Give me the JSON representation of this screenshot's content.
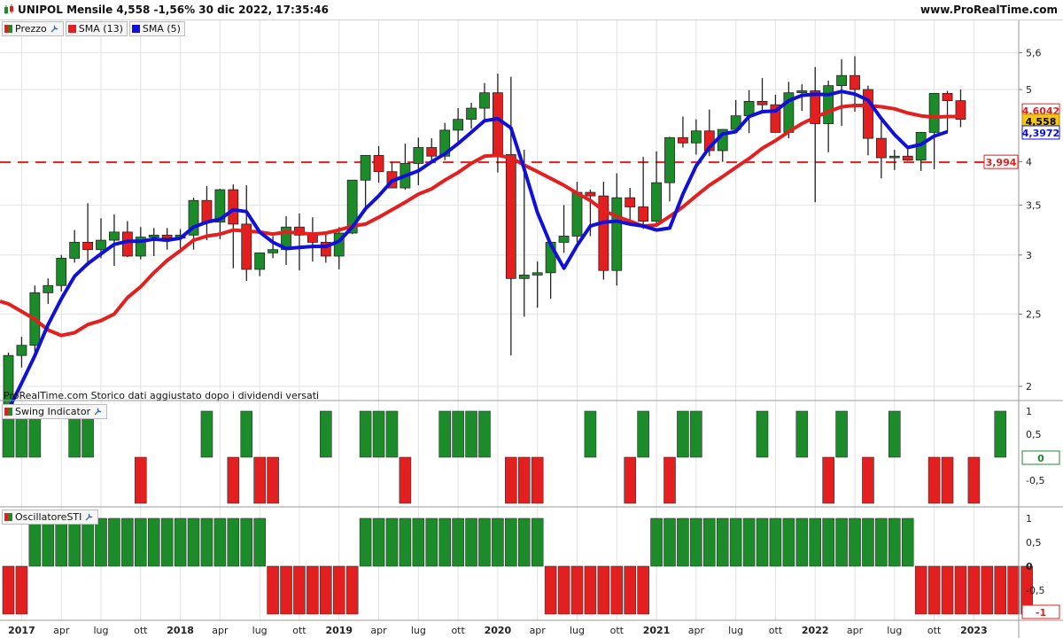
{
  "header": {
    "title": "UNIPOL Mensile 4,558 -1,56% 30 dic 2022, 17:35:46",
    "site": "www.ProRealTime.com"
  },
  "price_panel": {
    "legend": [
      "Prezzo",
      "SMA (13)",
      "SMA (5)"
    ],
    "note": "ProRealTime.com Storico dati aggiustato dopo i dividendi versati",
    "last_price_label": "4,558",
    "sma13_label": "4,6042",
    "sma5_label": "4,3972",
    "hline_label": "3,994"
  },
  "swing_panel": {
    "legend": "Swing Indicator"
  },
  "osc_panel": {
    "legend": "OscillatoreSTI"
  },
  "colors": {
    "up": "#1c8c2a",
    "down": "#e41f1f",
    "sma13": "#e41f1f",
    "sma5": "#1010d8",
    "last": "#f5c518"
  },
  "chart_data": [
    {
      "type": "candlestick",
      "title": "UNIPOL Mensile",
      "y_ticks": [
        2,
        2.5,
        3,
        3.5,
        4,
        5,
        5.6
      ],
      "y_tick_labels": [
        "2",
        "2,5",
        "3",
        "3,5",
        "4",
        "5",
        "5,6"
      ],
      "x_tick_labels": [
        "2017",
        "apr",
        "lug",
        "ott",
        "2018",
        "apr",
        "lug",
        "ott",
        "2019",
        "apr",
        "lug",
        "ott",
        "2020",
        "apr",
        "lug",
        "ott",
        "2021",
        "apr",
        "lug",
        "ott",
        "2022",
        "apr",
        "lug",
        "ott",
        "2023"
      ],
      "ylim": [
        1.65,
        5.7
      ],
      "scale": "log",
      "hline": 3.994,
      "x": [
        "2016-12",
        "2017-01",
        "2017-02",
        "2017-03",
        "2017-04",
        "2017-05",
        "2017-06",
        "2017-07",
        "2017-08",
        "2017-09",
        "2017-10",
        "2017-11",
        "2017-12",
        "2018-01",
        "2018-02",
        "2018-03",
        "2018-04",
        "2018-05",
        "2018-06",
        "2018-07",
        "2018-08",
        "2018-09",
        "2018-10",
        "2018-11",
        "2018-12",
        "2019-01",
        "2019-02",
        "2019-03",
        "2019-04",
        "2019-05",
        "2019-06",
        "2019-07",
        "2019-08",
        "2019-09",
        "2019-10",
        "2019-11",
        "2019-12",
        "2020-01",
        "2020-02",
        "2020-03",
        "2020-04",
        "2020-05",
        "2020-06",
        "2020-07",
        "2020-08",
        "2020-09",
        "2020-10",
        "2020-11",
        "2020-12",
        "2021-01",
        "2021-02",
        "2021-03",
        "2021-04",
        "2021-05",
        "2021-06",
        "2021-07",
        "2021-08",
        "2021-09",
        "2021-10",
        "2021-11",
        "2021-12",
        "2022-01",
        "2022-02",
        "2022-03",
        "2022-04",
        "2022-05",
        "2022-06",
        "2022-07",
        "2022-08",
        "2022-09",
        "2022-10",
        "2022-11",
        "2022-12"
      ],
      "open": [
        1.78,
        2.2,
        2.27,
        2.67,
        2.73,
        2.97,
        3.12,
        3.05,
        3.14,
        3.22,
        2.99,
        3.17,
        3.19,
        3.16,
        3.19,
        3.55,
        3.32,
        3.67,
        3.3,
        2.87,
        3.02,
        3.05,
        3.27,
        3.19,
        3.12,
        2.99,
        3.21,
        3.78,
        4.08,
        3.88,
        3.69,
        3.98,
        4.18,
        4.07,
        4.41,
        4.56,
        4.72,
        4.95,
        4.09,
        2.79,
        2.82,
        2.84,
        3.12,
        3.18,
        3.64,
        3.6,
        2.86,
        3.58,
        3.48,
        3.33,
        3.75,
        4.31,
        4.24,
        4.4,
        4.14,
        4.42,
        4.61,
        4.82,
        4.77,
        4.38,
        4.95,
        4.98,
        4.5,
        5.06,
        5.22,
        5.0,
        4.3,
        4.05,
        4.07,
        4.02,
        4.38,
        4.94,
        4.83
      ],
      "high": [
        2.22,
        2.33,
        2.73,
        2.79,
        3.0,
        3.24,
        3.52,
        3.36,
        3.4,
        3.33,
        3.27,
        3.26,
        3.26,
        3.25,
        3.58,
        3.71,
        3.68,
        3.73,
        3.72,
        3.02,
        3.18,
        3.38,
        3.41,
        3.37,
        3.22,
        3.27,
        3.46,
        4.06,
        4.2,
        4.0,
        4.23,
        4.31,
        4.3,
        4.51,
        4.72,
        4.8,
        5.1,
        5.25,
        5.2,
        4.15,
        2.94,
        3.06,
        3.5,
        3.76,
        3.67,
        3.76,
        3.86,
        3.69,
        4.06,
        4.13,
        4.32,
        4.6,
        4.56,
        4.7,
        4.33,
        4.84,
        4.99,
        5.18,
        4.92,
        5.12,
        5.08,
        5.36,
        5.14,
        5.49,
        5.54,
        5.06,
        4.54,
        4.15,
        4.19,
        4.21,
        4.5,
        4.98,
        5.0
      ],
      "low": [
        1.72,
        2.12,
        2.22,
        2.58,
        2.68,
        2.93,
        2.9,
        2.97,
        2.9,
        2.98,
        2.96,
        2.99,
        3.05,
        3.06,
        3.05,
        3.14,
        3.15,
        2.88,
        2.77,
        2.81,
        2.97,
        2.91,
        2.86,
        2.94,
        2.93,
        2.87,
        3.2,
        3.43,
        3.75,
        3.78,
        3.67,
        3.72,
        3.99,
        4.02,
        4.25,
        4.43,
        4.54,
        3.87,
        2.2,
        2.48,
        2.55,
        2.62,
        3.02,
        3.12,
        3.18,
        2.78,
        2.73,
        3.29,
        3.25,
        3.28,
        3.54,
        4.18,
        4.09,
        4.07,
        4.0,
        4.39,
        4.37,
        4.64,
        4.46,
        4.3,
        4.68,
        3.53,
        4.12,
        4.47,
        4.67,
        4.08,
        3.8,
        3.9,
        4.01,
        3.89,
        3.91,
        4.38,
        4.45
      ],
      "close": [
        2.2,
        2.27,
        2.67,
        2.73,
        2.97,
        3.12,
        3.05,
        3.14,
        3.22,
        2.99,
        3.17,
        3.19,
        3.16,
        3.19,
        3.55,
        3.32,
        3.67,
        3.3,
        2.87,
        3.02,
        3.05,
        3.27,
        3.19,
        3.12,
        2.99,
        3.21,
        3.78,
        4.08,
        3.88,
        3.69,
        3.98,
        4.18,
        4.07,
        4.41,
        4.56,
        4.72,
        4.95,
        4.09,
        2.79,
        2.82,
        2.84,
        3.12,
        3.18,
        3.64,
        3.6,
        2.86,
        3.58,
        3.48,
        3.33,
        3.75,
        4.31,
        4.24,
        4.4,
        4.14,
        4.42,
        4.61,
        4.82,
        4.77,
        4.38,
        4.95,
        4.98,
        4.5,
        5.06,
        5.22,
        5.0,
        4.3,
        4.05,
        4.07,
        4.02,
        4.38,
        4.94,
        4.83,
        4.56
      ],
      "series": [
        {
          "name": "SMA (13)",
          "values": [
            2.58,
            2.52,
            2.46,
            2.38,
            2.34,
            2.36,
            2.42,
            2.45,
            2.5,
            2.63,
            2.72,
            2.84,
            2.95,
            3.04,
            3.14,
            3.18,
            3.2,
            3.24,
            3.23,
            3.22,
            3.2,
            3.22,
            3.21,
            3.2,
            3.21,
            3.24,
            3.28,
            3.3,
            3.37,
            3.45,
            3.53,
            3.62,
            3.68,
            3.78,
            3.87,
            3.98,
            4.07,
            4.08,
            4.05,
            3.96,
            3.88,
            3.8,
            3.72,
            3.63,
            3.55,
            3.44,
            3.38,
            3.33,
            3.28,
            3.29,
            3.38,
            3.48,
            3.6,
            3.72,
            3.82,
            3.93,
            4.04,
            4.17,
            4.27,
            4.39,
            4.5,
            4.59,
            4.67,
            4.74,
            4.76,
            4.76,
            4.74,
            4.71,
            4.65,
            4.61,
            4.59,
            4.6,
            4.6
          ]
        },
        {
          "name": "SMA (5)",
          "values": [
            1.86,
            2.02,
            2.2,
            2.42,
            2.62,
            2.81,
            2.92,
            3.01,
            3.1,
            3.13,
            3.13,
            3.15,
            3.14,
            3.16,
            3.27,
            3.32,
            3.35,
            3.45,
            3.43,
            3.22,
            3.12,
            3.06,
            3.07,
            3.08,
            3.08,
            3.13,
            3.27,
            3.46,
            3.6,
            3.77,
            3.83,
            3.89,
            4.0,
            4.1,
            4.23,
            4.38,
            4.54,
            4.57,
            4.44,
            3.91,
            3.42,
            3.1,
            2.88,
            3.09,
            3.28,
            3.32,
            3.33,
            3.3,
            3.28,
            3.24,
            3.26,
            3.62,
            3.95,
            4.18,
            4.36,
            4.39,
            4.6,
            4.67,
            4.68,
            4.83,
            4.91,
            4.93,
            4.92,
            4.97,
            4.93,
            4.84,
            4.57,
            4.35,
            4.18,
            4.22,
            4.33,
            4.39
          ]
        }
      ]
    },
    {
      "type": "bar",
      "title": "Swing Indicator",
      "y_ticks": [
        1,
        0.5,
        -0.5
      ],
      "y_tick_labels": [
        "1",
        "0,5",
        "-0,5"
      ],
      "last_label": "0",
      "ylim": [
        -1,
        1
      ],
      "values": [
        1,
        1,
        1,
        0,
        0,
        1,
        1,
        0,
        0,
        0,
        -1,
        0,
        0,
        0,
        0,
        1,
        0,
        -1,
        1,
        -1,
        -1,
        0,
        0,
        0,
        1,
        0,
        0,
        1,
        1,
        1,
        -1,
        0,
        0,
        1,
        1,
        1,
        1,
        0,
        -1,
        -1,
        -1,
        0,
        0,
        0,
        1,
        0,
        0,
        -1,
        1,
        0,
        -1,
        1,
        1,
        0,
        0,
        0,
        0,
        1,
        0,
        0,
        1,
        0,
        -1,
        1,
        0,
        -1,
        0,
        1,
        0,
        0,
        -1,
        -1,
        0,
        -1,
        0,
        1,
        0
      ]
    },
    {
      "type": "bar",
      "title": "OscillatoreSTI",
      "y_ticks": [
        1,
        0.5,
        0,
        -0.5
      ],
      "y_tick_labels": [
        "1",
        "0,5",
        "0",
        "-0,5"
      ],
      "last_label": "-1",
      "ylim": [
        -1,
        1
      ],
      "values": [
        -1,
        -1,
        1,
        1,
        1,
        1,
        1,
        1,
        1,
        1,
        1,
        1,
        1,
        1,
        1,
        1,
        1,
        1,
        1,
        1,
        -1,
        -1,
        -1,
        -1,
        -1,
        -1,
        -1,
        1,
        1,
        1,
        1,
        1,
        1,
        1,
        1,
        1,
        1,
        1,
        1,
        1,
        1,
        -1,
        -1,
        -1,
        -1,
        -1,
        -1,
        -1,
        -1,
        1,
        1,
        1,
        1,
        1,
        1,
        1,
        1,
        1,
        1,
        1,
        1,
        1,
        1,
        1,
        1,
        1,
        1,
        1,
        1,
        -1,
        -1,
        -1,
        -1,
        -1,
        -1,
        -1,
        -1,
        -1
      ]
    }
  ]
}
